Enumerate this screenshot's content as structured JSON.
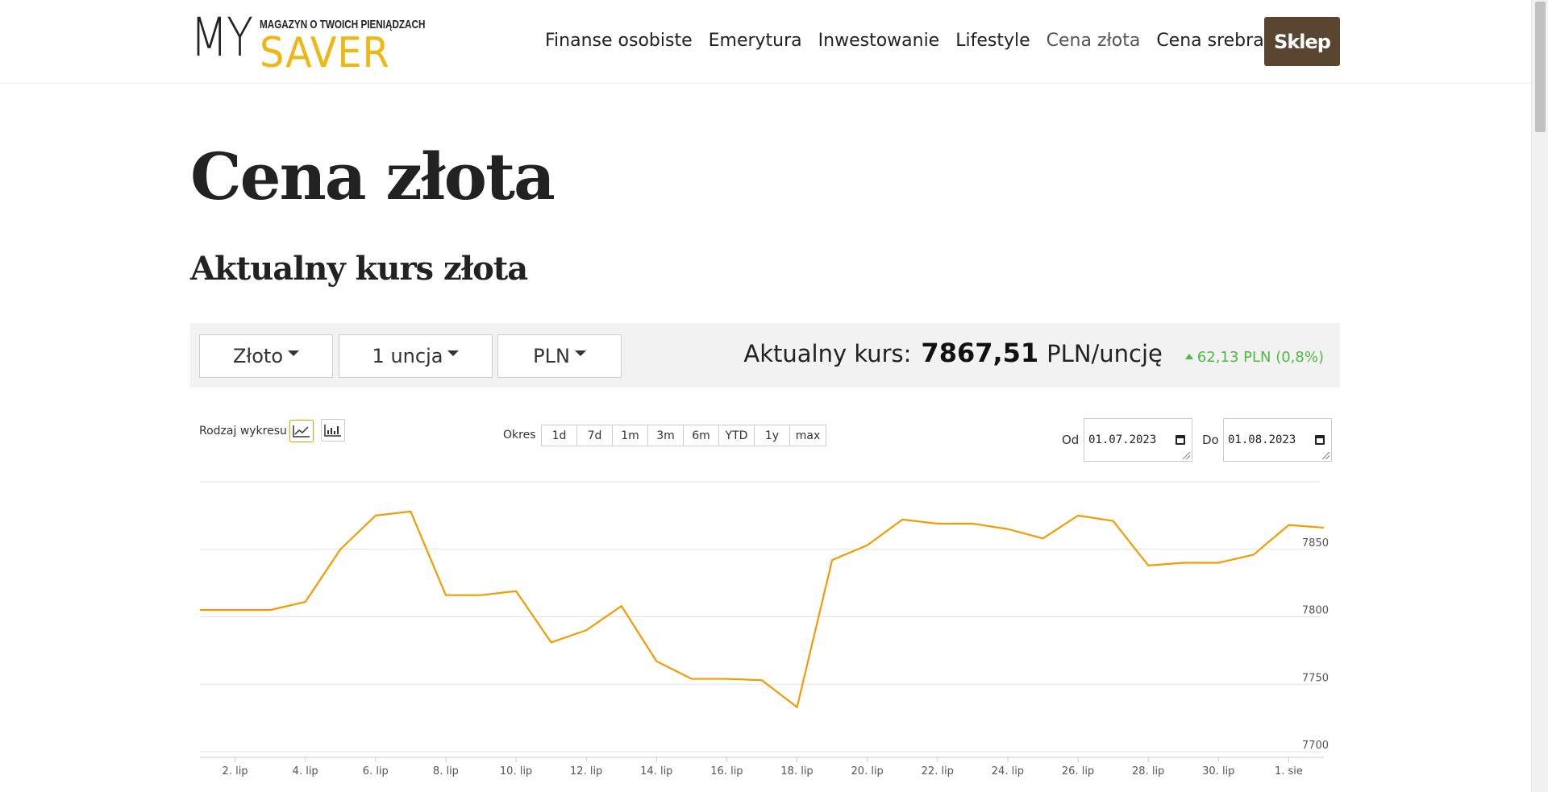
{
  "header": {
    "logo": {
      "my": "MY",
      "tagline": "MAGAZYN O TWOICH PIENIĄDZACH",
      "saver": "SAVER"
    },
    "nav": [
      "Finanse osobiste",
      "Emerytura",
      "Inwestowanie",
      "Lifestyle",
      "Cena złota",
      "Cena srebra"
    ],
    "shop_label": "Sklep"
  },
  "page": {
    "title": "Cena złota",
    "subtitle": "Aktualny kurs złota"
  },
  "selectors": {
    "metal": "Złoto",
    "weight": "1 uncja",
    "currency": "PLN"
  },
  "rate": {
    "label": "Aktualny kurs:",
    "value": "7867,51",
    "unit": "PLN/uncję",
    "change": "62,13 PLN (0,8%)"
  },
  "controls": {
    "chart_type_label": "Rodzaj wykresu",
    "chart_types": [
      "line-chart-icon",
      "bar-chart-icon"
    ],
    "period_label": "Okres",
    "periods": [
      "1d",
      "7d",
      "1m",
      "3m",
      "6m",
      "YTD",
      "1y",
      "max"
    ],
    "from_label": "Od",
    "from_value": "01.07.2023",
    "to_label": "Do",
    "to_value": "01.08.2023"
  },
  "colors": {
    "accent": "#f59b00",
    "brand_brown": "#5a4530",
    "logo_yellow": "#f0b712",
    "positive": "#4cbb3f"
  },
  "chart_data": {
    "type": "line",
    "x": [
      "1. lip",
      "2. lip",
      "3. lip",
      "4. lip",
      "5. lip",
      "6. lip",
      "7. lip",
      "8. lip",
      "9. lip",
      "10. lip",
      "11. lip",
      "12. lip",
      "13. lip",
      "14. lip",
      "15. lip",
      "16. lip",
      "17. lip",
      "18. lip",
      "19. lip",
      "20. lip",
      "21. lip",
      "22. lip",
      "23. lip",
      "24. lip",
      "25. lip",
      "26. lip",
      "27. lip",
      "28. lip",
      "29. lip",
      "30. lip",
      "31. lip",
      "1. sie"
    ],
    "values": [
      7805,
      7805,
      7805,
      7811,
      7850,
      7875,
      7878,
      7816,
      7816,
      7819,
      7781,
      7790,
      7808,
      7767,
      7754,
      7754,
      7753,
      7733,
      7842,
      7853,
      7872,
      7869,
      7869,
      7865,
      7858,
      7875,
      7871,
      7838,
      7840,
      7840,
      7846,
      7868,
      7866
    ],
    "x_tick_labels": [
      "2. lip",
      "4. lip",
      "6. lip",
      "8. lip",
      "10. lip",
      "12. lip",
      "14. lip",
      "16. lip",
      "18. lip",
      "20. lip",
      "22. lip",
      "24. lip",
      "26. lip",
      "28. lip",
      "30. lip",
      "1. sie"
    ],
    "y_ticks": [
      7700,
      7750,
      7800,
      7850
    ],
    "ylim": [
      7700,
      7900
    ],
    "grid": true,
    "color": "#f59b00"
  }
}
